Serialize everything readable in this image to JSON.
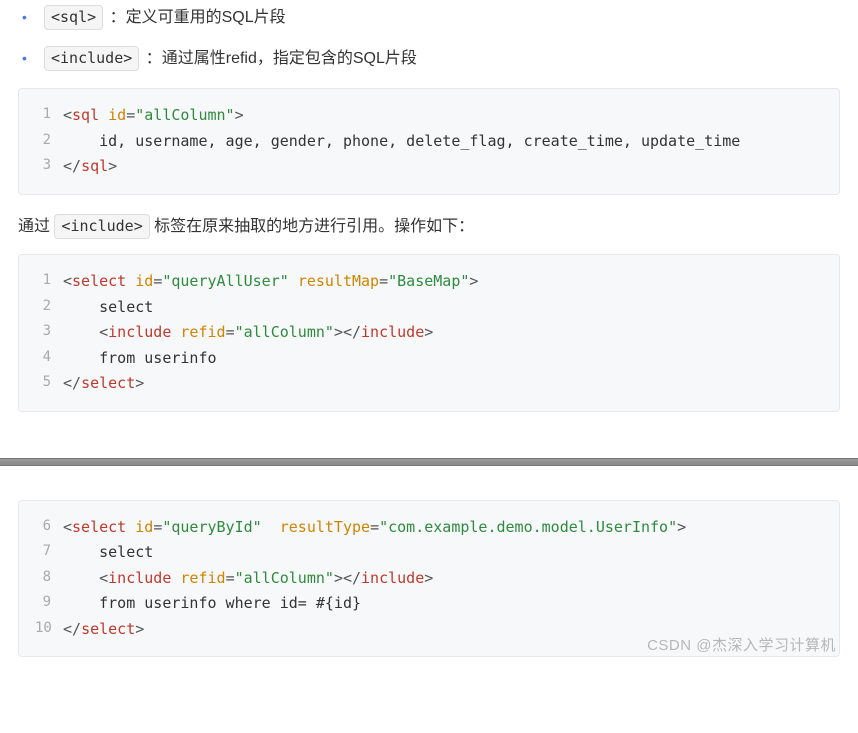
{
  "bullets": [
    {
      "tag": "<sql>",
      "desc": "：定义可重用的SQL片段"
    },
    {
      "tag": "<include>",
      "desc": "：通过属性refid，指定包含的SQL片段"
    }
  ],
  "code1": {
    "lines": [
      {
        "n": "1",
        "tokens": [
          {
            "c": "tok-punct",
            "t": "<"
          },
          {
            "c": "tok-tag",
            "t": "sql"
          },
          {
            "c": "tok-plain",
            "t": " "
          },
          {
            "c": "tok-attr",
            "t": "id"
          },
          {
            "c": "tok-punct",
            "t": "="
          },
          {
            "c": "tok-str",
            "t": "\"allColumn\""
          },
          {
            "c": "tok-punct",
            "t": ">"
          }
        ]
      },
      {
        "n": "2",
        "tokens": [
          {
            "c": "tok-plain",
            "t": "    id, username, age, gender, phone, delete_flag, create_time, update_time"
          }
        ]
      },
      {
        "n": "3",
        "tokens": [
          {
            "c": "tok-punct",
            "t": "</"
          },
          {
            "c": "tok-tag",
            "t": "sql"
          },
          {
            "c": "tok-punct",
            "t": ">"
          }
        ]
      }
    ]
  },
  "para1": {
    "prefix": "通过 ",
    "tag": "<include>",
    "suffix": " 标签在原来抽取的地方进行引用。操作如下："
  },
  "code2": {
    "lines": [
      {
        "n": "1",
        "tokens": [
          {
            "c": "tok-punct",
            "t": "<"
          },
          {
            "c": "tok-tag",
            "t": "select"
          },
          {
            "c": "tok-plain",
            "t": " "
          },
          {
            "c": "tok-attr",
            "t": "id"
          },
          {
            "c": "tok-punct",
            "t": "="
          },
          {
            "c": "tok-str",
            "t": "\"queryAllUser\""
          },
          {
            "c": "tok-plain",
            "t": " "
          },
          {
            "c": "tok-attr",
            "t": "resultMap"
          },
          {
            "c": "tok-punct",
            "t": "="
          },
          {
            "c": "tok-str",
            "t": "\"BaseMap\""
          },
          {
            "c": "tok-punct",
            "t": ">"
          }
        ]
      },
      {
        "n": "2",
        "tokens": [
          {
            "c": "tok-plain",
            "t": "    select"
          }
        ]
      },
      {
        "n": "3",
        "tokens": [
          {
            "c": "tok-plain",
            "t": "    "
          },
          {
            "c": "tok-punct",
            "t": "<"
          },
          {
            "c": "tok-tag",
            "t": "include"
          },
          {
            "c": "tok-plain",
            "t": " "
          },
          {
            "c": "tok-attr",
            "t": "refid"
          },
          {
            "c": "tok-punct",
            "t": "="
          },
          {
            "c": "tok-str",
            "t": "\"allColumn\""
          },
          {
            "c": "tok-punct",
            "t": ">"
          },
          {
            "c": "tok-punct",
            "t": "</"
          },
          {
            "c": "tok-tag",
            "t": "include"
          },
          {
            "c": "tok-punct",
            "t": ">"
          }
        ]
      },
      {
        "n": "4",
        "tokens": [
          {
            "c": "tok-plain",
            "t": "    from userinfo"
          }
        ]
      },
      {
        "n": "5",
        "tokens": [
          {
            "c": "tok-punct",
            "t": "</"
          },
          {
            "c": "tok-tag",
            "t": "select"
          },
          {
            "c": "tok-punct",
            "t": ">"
          }
        ]
      }
    ]
  },
  "code3": {
    "lines": [
      {
        "n": "6",
        "tokens": [
          {
            "c": "tok-punct",
            "t": "<"
          },
          {
            "c": "tok-tag",
            "t": "select"
          },
          {
            "c": "tok-plain",
            "t": " "
          },
          {
            "c": "tok-attr",
            "t": "id"
          },
          {
            "c": "tok-punct",
            "t": "="
          },
          {
            "c": "tok-str",
            "t": "\"queryById\""
          },
          {
            "c": "tok-plain",
            "t": "  "
          },
          {
            "c": "tok-attr",
            "t": "resultType"
          },
          {
            "c": "tok-punct",
            "t": "="
          },
          {
            "c": "tok-str",
            "t": "\"com.example.demo.model.UserInfo\""
          },
          {
            "c": "tok-punct",
            "t": ">"
          }
        ]
      },
      {
        "n": "7",
        "tokens": [
          {
            "c": "tok-plain",
            "t": "    select"
          }
        ]
      },
      {
        "n": "8",
        "tokens": [
          {
            "c": "tok-plain",
            "t": "    "
          },
          {
            "c": "tok-punct",
            "t": "<"
          },
          {
            "c": "tok-tag",
            "t": "include"
          },
          {
            "c": "tok-plain",
            "t": " "
          },
          {
            "c": "tok-attr",
            "t": "refid"
          },
          {
            "c": "tok-punct",
            "t": "="
          },
          {
            "c": "tok-str",
            "t": "\"allColumn\""
          },
          {
            "c": "tok-punct",
            "t": ">"
          },
          {
            "c": "tok-punct",
            "t": "</"
          },
          {
            "c": "tok-tag",
            "t": "include"
          },
          {
            "c": "tok-punct",
            "t": ">"
          }
        ]
      },
      {
        "n": "9",
        "tokens": [
          {
            "c": "tok-plain",
            "t": "    from userinfo where id= #{id}"
          }
        ]
      },
      {
        "n": "10",
        "tokens": [
          {
            "c": "tok-punct",
            "t": "</"
          },
          {
            "c": "tok-tag",
            "t": "select"
          },
          {
            "c": "tok-punct",
            "t": ">"
          }
        ]
      }
    ]
  },
  "watermark": "CSDN @杰深入学习计算机"
}
